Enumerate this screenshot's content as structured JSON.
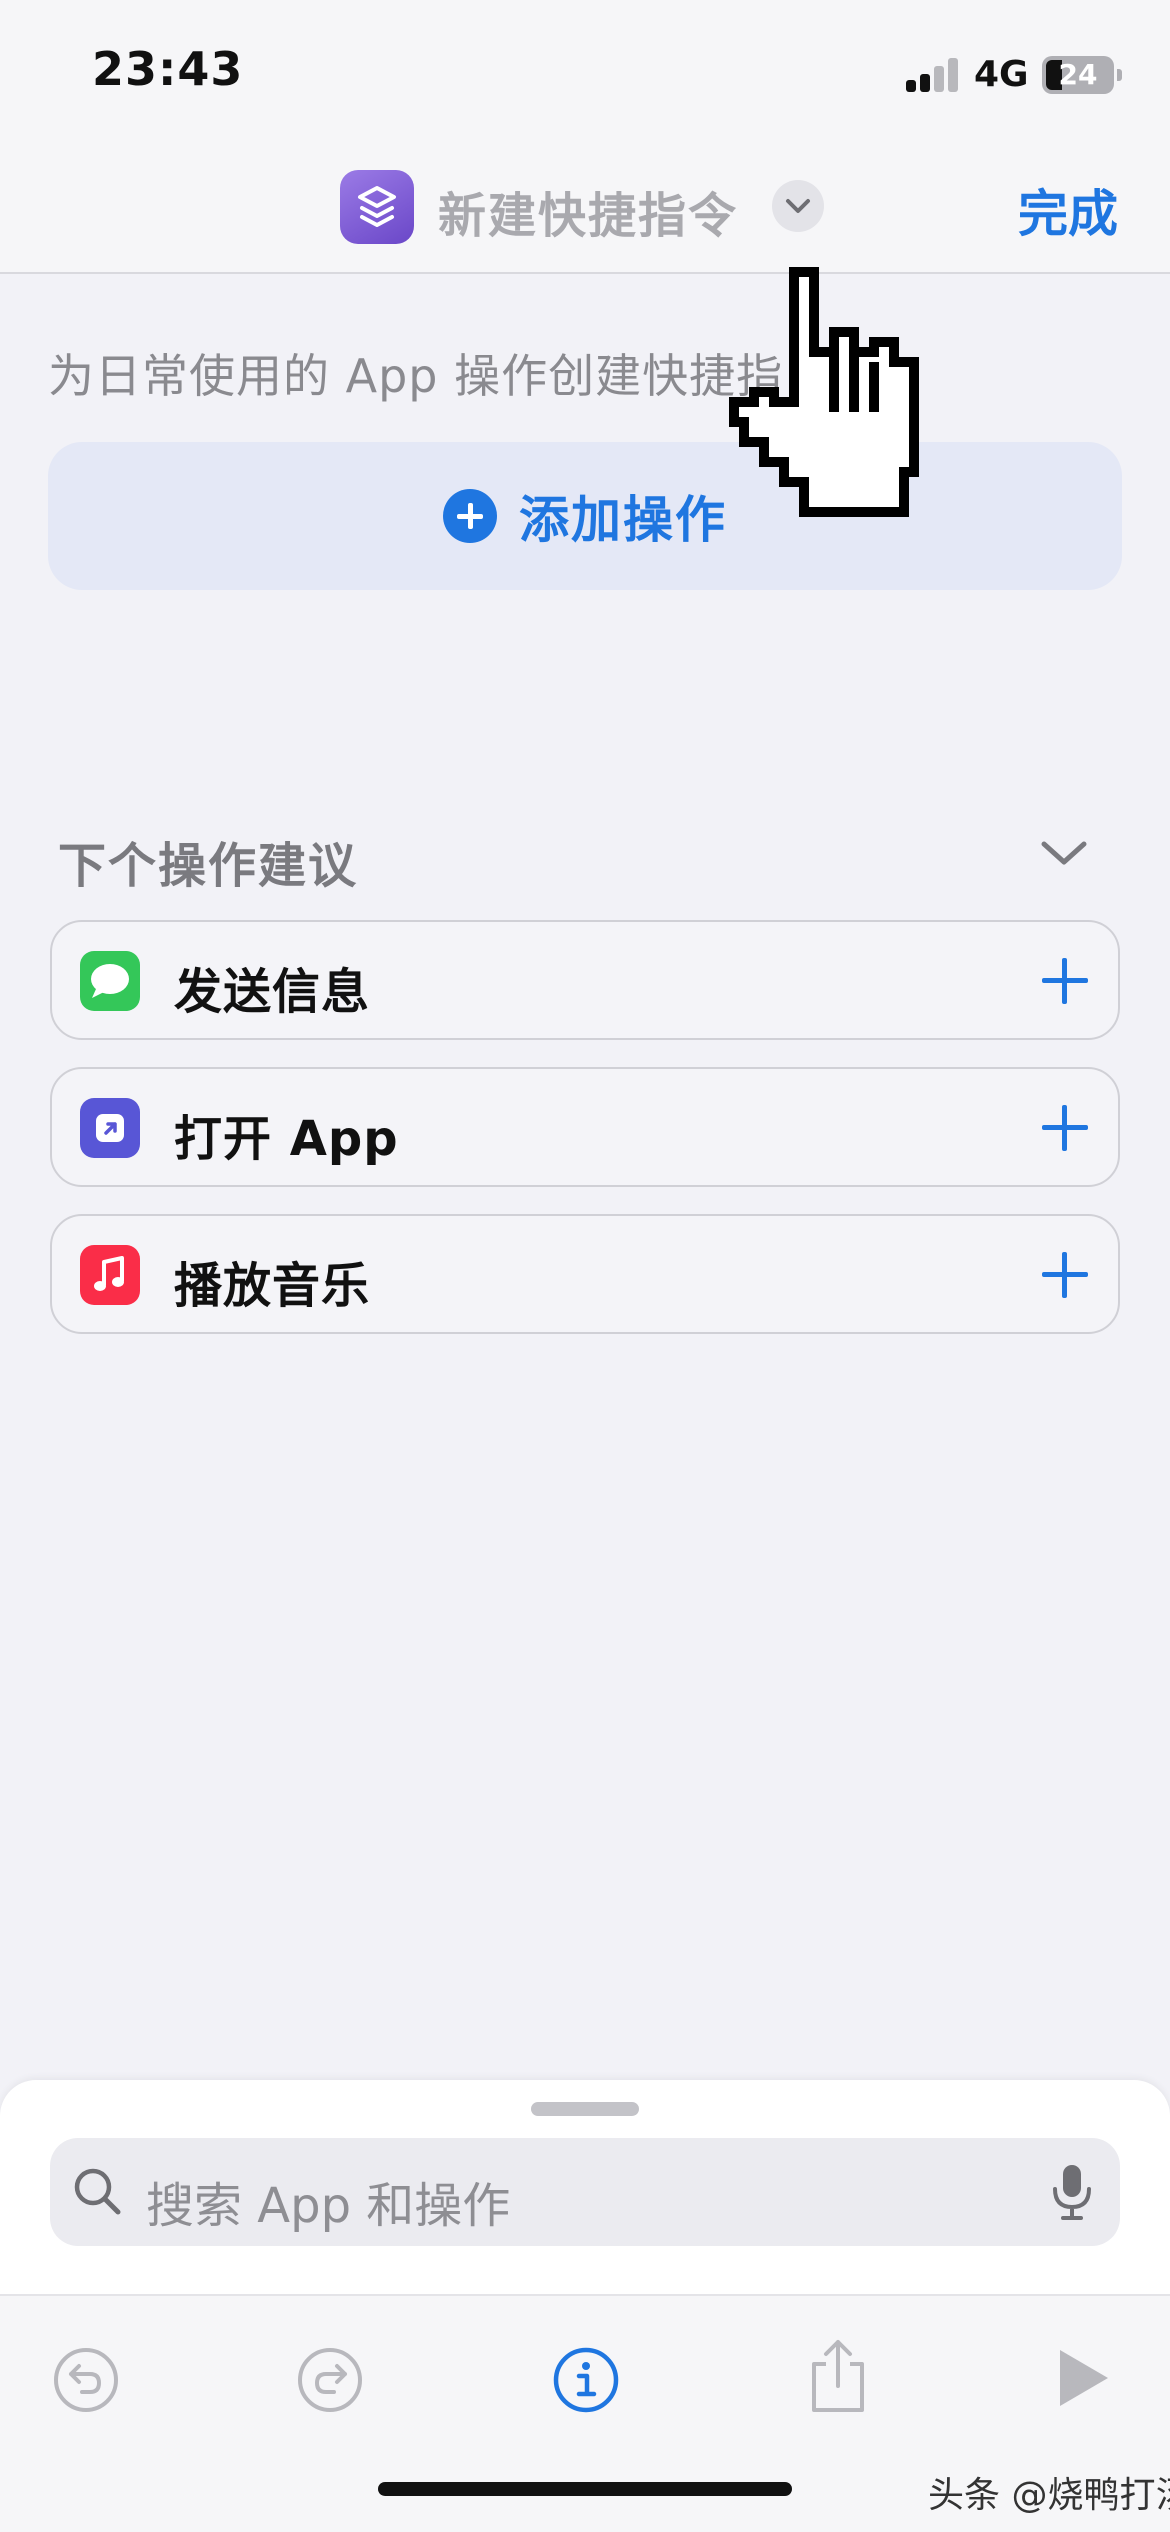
{
  "status_bar": {
    "time": "23:43",
    "network": "4G",
    "battery": "24"
  },
  "nav": {
    "title": "新建快捷指令",
    "done_label": "完成"
  },
  "main": {
    "hint": "为日常使用的 App 操作创建快捷指",
    "add_action_label": "添加操作",
    "suggestions_title": "下个操作建议",
    "suggestions": [
      {
        "label": "发送信息",
        "icon": "messages-icon",
        "color": "#34C759"
      },
      {
        "label": "打开 App",
        "icon": "open-app-icon",
        "color": "#5856D6"
      },
      {
        "label": "播放音乐",
        "icon": "music-icon",
        "color": "#FA2D48"
      }
    ]
  },
  "bottom_sheet": {
    "search_placeholder": "搜索 App 和操作"
  },
  "toolbar": {
    "icons": [
      "undo-icon",
      "redo-icon",
      "info-icon",
      "share-icon",
      "play-icon"
    ]
  },
  "watermark": "头条 @烧鸭打汤",
  "colors": {
    "accent": "#1F76E0",
    "background": "#F2F2F7"
  }
}
